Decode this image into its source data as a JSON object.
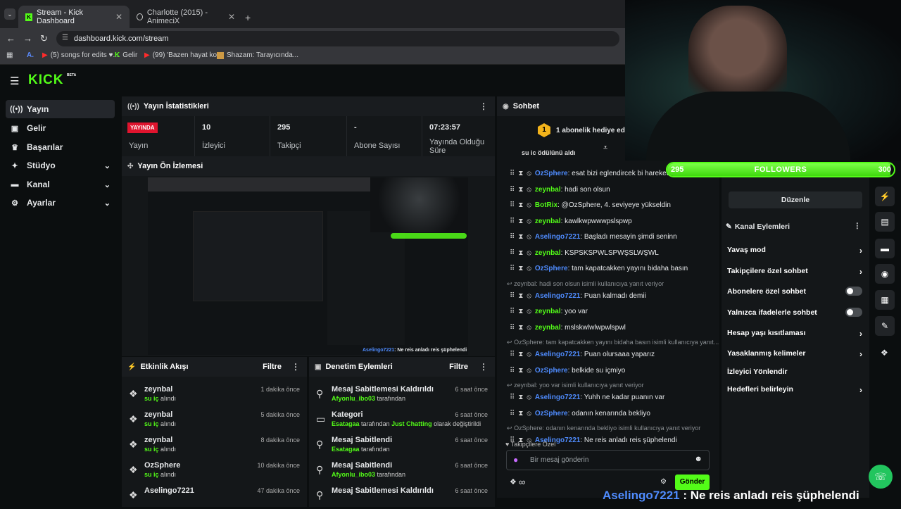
{
  "browser": {
    "tabs": [
      {
        "title": "Stream - Kick Dashboard",
        "active": true
      },
      {
        "title": "Charlotte (2015) - AnimeciX",
        "active": false
      }
    ],
    "url": "dashboard.kick.com/stream",
    "bookmarks": [
      "(5) songs for edits ♥...",
      "Gelir",
      "(99) 'Bazen hayat ko...",
      "Shazam: Tarayıcında..."
    ]
  },
  "kick": {
    "logo": "KICK",
    "beta": "BETA"
  },
  "sidebar": {
    "items": [
      {
        "label": "Yayın",
        "icon": "broadcast-icon"
      },
      {
        "label": "Gelir",
        "icon": "revenue-icon"
      },
      {
        "label": "Başarılar",
        "icon": "trophy-icon"
      },
      {
        "label": "Stüdyo",
        "icon": "studio-icon"
      },
      {
        "label": "Kanal",
        "icon": "channel-icon"
      },
      {
        "label": "Ayarlar",
        "icon": "gear-icon"
      }
    ]
  },
  "stats": {
    "title": "Yayın İstatistikleri",
    "status_badge": "YAYINDA",
    "status_label": "Yayın",
    "viewers_value": "10",
    "viewers_label": "İzleyici",
    "followers_value": "295",
    "followers_label": "Takipçi",
    "subs_value": "-",
    "subs_label": "Abone Sayısı",
    "uptime_value": "07:23:57",
    "uptime_label": "Yayında Olduğu Süre"
  },
  "preview": {
    "title": "Yayın Ön İzlemesi",
    "caption_user": "Aselingo7221",
    "caption_text": ": Ne reis anladı reis şüphelendi"
  },
  "activity": {
    "title": "Etkinlik Akışı",
    "filter": "Filtre",
    "rows": [
      {
        "user": "zeynbal",
        "item": "su iç",
        "action": "alındı",
        "time": "1 dakika önce"
      },
      {
        "user": "zeynbal",
        "item": "su iç",
        "action": "alındı",
        "time": "5 dakika önce"
      },
      {
        "user": "zeynbal",
        "item": "su iç",
        "action": "alındı",
        "time": "8 dakika önce"
      },
      {
        "user": "OzSphere",
        "item": "su iç",
        "action": "alındı",
        "time": "10 dakika önce"
      },
      {
        "user": "Aselingo7221",
        "item": "",
        "action": "",
        "time": "47 dakika önce"
      }
    ]
  },
  "moderation": {
    "title": "Denetim Eylemleri",
    "filter": "Filtre",
    "rows": [
      {
        "title": "Mesaj Sabitlemesi Kaldırıldı",
        "by": "Afyonlu_ibo03",
        "rest": "tarafından",
        "time": "6 saat önce"
      },
      {
        "title": "Kategori",
        "by": "Esatagaa",
        "rest": "tarafından",
        "cat": "Just Chatting",
        "rest2": "olarak değiştirildi",
        "time": "6 saat önce"
      },
      {
        "title": "Mesaj Sabitlendi",
        "by": "Esatagaa",
        "rest": "tarafından",
        "time": "6 saat önce"
      },
      {
        "title": "Mesaj Sabitlendi",
        "by": "Afyonlu_ibo03",
        "rest": "tarafından",
        "time": "6 saat önce"
      },
      {
        "title": "Mesaj Sabitlemesi Kaldırıldı",
        "by": "",
        "rest": "",
        "time": "6 saat önce"
      }
    ]
  },
  "chat": {
    "title": "Sohbet",
    "gift_banner": "1 abonelik hediye ederek",
    "gift_count": "1",
    "clipped_line": "su iç ödülünü aldı",
    "messages": [
      {
        "type": "msg",
        "user": "OzSphere",
        "color": "#4f8cff",
        "text": ": esat bizi eglendircek bi hareket y"
      },
      {
        "type": "msg",
        "user": "zeynbal",
        "color": "#53fc18",
        "text": ": hadi son olsun"
      },
      {
        "type": "msg",
        "user": "BotRix",
        "color": "#53fc18",
        "text": ": @OzSphere, 4. seviyeye yükseldin"
      },
      {
        "type": "msg",
        "user": "zeynbal",
        "color": "#53fc18",
        "text": ": kawlkwpwwwpslspwp"
      },
      {
        "type": "msg",
        "user": "Aselingo7221",
        "color": "#4f8cff",
        "text": ": Başladı mesayin şimdi seninn"
      },
      {
        "type": "msg",
        "user": "zeynbal",
        "color": "#53fc18",
        "text": ": KSPSKSPWLSPWŞSLWŞWL"
      },
      {
        "type": "msg",
        "user": "OzSphere",
        "color": "#4f8cff",
        "text": ": tam kapatcakken yayını bidaha basın"
      },
      {
        "type": "reply",
        "text": "zeynbal: hadi son olsun isimli kullanıcıya yanıt veriyor"
      },
      {
        "type": "msg",
        "user": "Aselingo7221",
        "color": "#4f8cff",
        "text": ": Puan kalmadı demii"
      },
      {
        "type": "msg",
        "user": "zeynbal",
        "color": "#53fc18",
        "text": ": yoo var"
      },
      {
        "type": "msg",
        "user": "zeynbal",
        "color": "#53fc18",
        "text": ": mslskwlwlwpwlspwl"
      },
      {
        "type": "reply",
        "text": "OzSphere: tam kapatcakken yayını bidaha basın isimli kullanıcıya yanıt..."
      },
      {
        "type": "msg",
        "user": "Aselingo7221",
        "color": "#4f8cff",
        "text": ": Puan olursaaa yaparız"
      },
      {
        "type": "msg",
        "user": "OzSphere",
        "color": "#4f8cff",
        "text": ": belkide su içmiyo"
      },
      {
        "type": "reply",
        "text": "zeynbal: yoo var isimli kullanıcıya yanıt veriyor"
      },
      {
        "type": "msg",
        "user": "Aselingo7221",
        "color": "#4f8cff",
        "text": ": Yuhh ne kadar puanın var"
      },
      {
        "type": "msg",
        "user": "OzSphere",
        "color": "#4f8cff",
        "text": ": odanın kenarında bekliyo"
      },
      {
        "type": "reply",
        "text": "OzSphere: odanın kenarında bekliyo isimli kullanıcıya yanıt veriyor"
      },
      {
        "type": "msg",
        "user": "Aselingo7221",
        "color": "#4f8cff",
        "text": ": Ne reis anladı reis şüphelendi"
      }
    ],
    "followers_only": "Takipçilere Özel",
    "input_placeholder": "Bir mesaj gönderin",
    "send_label": "Gönder",
    "infinity": "∞"
  },
  "followers_goal": {
    "current": "295",
    "label": "FOLLOWERS",
    "target": "300",
    "progress": 0.983
  },
  "right_panel": {
    "edit_label": "Düzenle",
    "channel_actions_title": "Kanal Eylemleri",
    "items": [
      {
        "label": "Yavaş mod",
        "kind": "chevron"
      },
      {
        "label": "Takipçilere özel sohbet",
        "kind": "chevron"
      },
      {
        "label": "Abonelere özel sohbet",
        "kind": "toggle"
      },
      {
        "label": "Yalnızca ifadelerle sohbet",
        "kind": "toggle"
      },
      {
        "label": "Hesap yaşı kısıtlaması",
        "kind": "chevron"
      },
      {
        "label": "Yasaklanmış kelimeler",
        "kind": "chevron"
      },
      {
        "label": "İzleyici Yönlendir",
        "kind": "none"
      },
      {
        "label": "Hedefleri belirleyin",
        "kind": "chevron"
      }
    ]
  },
  "overlay_caption": {
    "user": "Aselingo7221",
    "text": " : Ne reis anladı reis şüphelendi"
  },
  "colors": {
    "accent": "#53fc18",
    "live_badge": "#e0142e",
    "blue_user": "#4f8cff"
  }
}
